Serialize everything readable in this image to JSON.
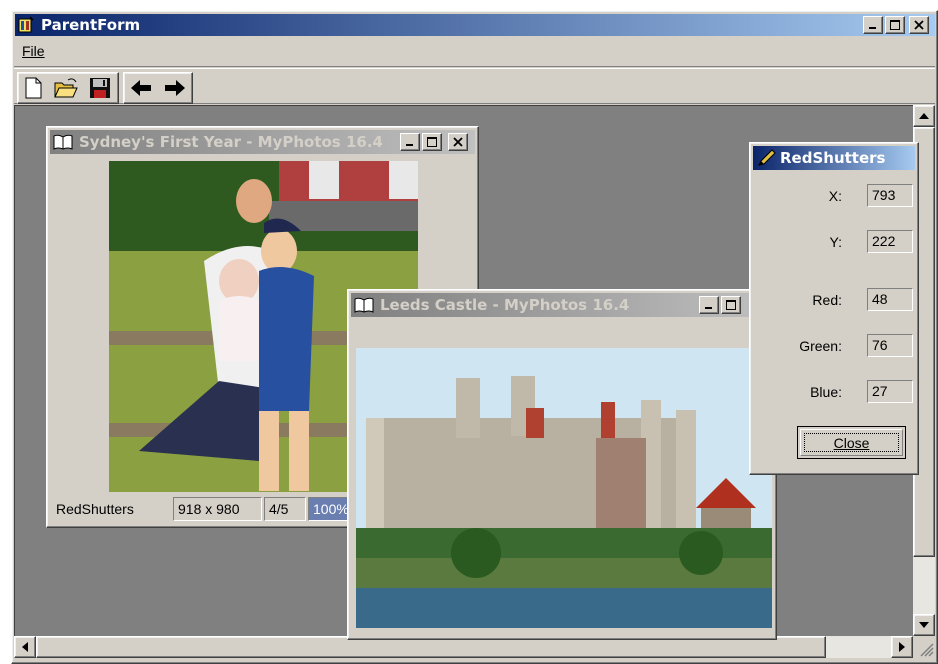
{
  "parent": {
    "title": "ParentForm",
    "menu": {
      "file_label": "File"
    },
    "toolbar": {
      "buttons": [
        {
          "name": "new",
          "icon": "new-document-icon"
        },
        {
          "name": "open",
          "icon": "open-folder-icon"
        },
        {
          "name": "save",
          "icon": "floppy-disk-icon"
        },
        {
          "name": "back",
          "icon": "arrow-left-icon"
        },
        {
          "name": "forward",
          "icon": "arrow-right-icon"
        }
      ]
    }
  },
  "sydney": {
    "title": "Sydney's First Year - MyPhotos 16.4",
    "status": {
      "name": "RedShutters",
      "size": "918 x 980",
      "index": "4/5",
      "zoom": "100%"
    }
  },
  "leeds": {
    "title": "Leeds Castle - MyPhotos 16.4"
  },
  "redshutters": {
    "title": "RedShutters",
    "x_label": "X:",
    "x_value": "793",
    "y_label": "Y:",
    "y_value": "222",
    "red_label": "Red:",
    "red_value": "48",
    "green_label": "Green:",
    "green_value": "76",
    "blue_label": "Blue:",
    "blue_value": "27",
    "close_label": "Close"
  },
  "colors": {
    "mdi_background": "#808080",
    "face": "#d4d0c8",
    "title_active": "#0a246a",
    "title_inactive": "#808080"
  }
}
